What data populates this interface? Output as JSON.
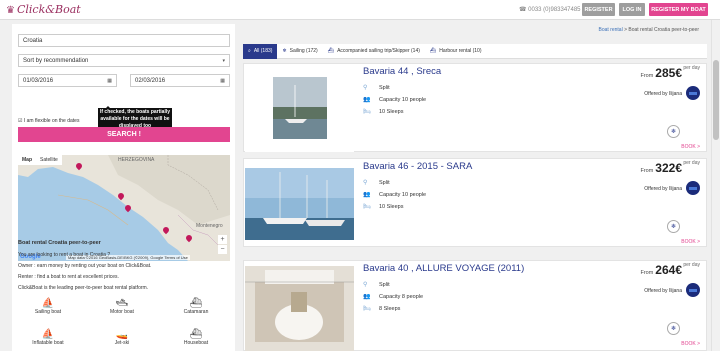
{
  "header": {
    "logo": "Click&Boat",
    "phone": "0033 (0)983347485",
    "register": "REGISTER",
    "login": "LOG IN",
    "register_boat": "REGISTER MY BOAT"
  },
  "search": {
    "destination": "Croatia",
    "sort": "Sort by recommendation",
    "date_from": "01/03/2016",
    "date_to": "02/03/2016",
    "flexible": "I am flexible on the dates",
    "tooltip": "If checked, the boats partially available for the dates will be displayed too",
    "button": "SEARCH !"
  },
  "map": {
    "map_tab": "Map",
    "satellite_tab": "Satellite",
    "labels": [
      "HERZEGOVINA",
      "Montenegro"
    ],
    "footer": "Map data ©2016 GeoBasis-DE/BKG (©2009), Google  Terms of Use",
    "google": "Google"
  },
  "info": {
    "title": "Boat rental Croatia peer-to-peer",
    "lines": [
      "You are looking to rent a boat in Croatia ?",
      "Owner : earn money by renting out your boat on Click&Boat.",
      "Renter : find a boat to rent at excellent prices.",
      "Click&Boat is the leading peer-to-peer boat rental platform."
    ]
  },
  "boat_types": [
    "Sailing boat",
    "Motor boat",
    "Catamaran",
    "Inflatable boat",
    "Jet-ski",
    "Houseboat"
  ],
  "breadcrumb": {
    "link": "Boat rental",
    "current": "Boat rental Croatia peer-to-peer"
  },
  "tabs": [
    {
      "label": "All (183)",
      "icon": "search-icon"
    },
    {
      "label": "Sailing (172)",
      "icon": "sailing-icon"
    },
    {
      "label": "Accompanied sailing trip/Skipper (14)",
      "icon": "skipper-icon"
    },
    {
      "label": "Harbour rental (10)",
      "icon": "harbour-icon"
    }
  ],
  "listings": [
    {
      "title": "Bavaria 44 , Sreca",
      "from": "From",
      "price": "285€",
      "per": "per day",
      "location": "Split",
      "capacity": "Capacity 10 people",
      "sleeps": "10 Sleeps",
      "offered": "Offered by Ilijana",
      "book": "BOOK >"
    },
    {
      "title": "Bavaria 46 - 2015 - SARA",
      "from": "From",
      "price": "322€",
      "per": "per day",
      "location": "Split",
      "capacity": "Capacity 10 people",
      "sleeps": "10 Sleeps",
      "offered": "Offered by Ilijana",
      "book": "BOOK >"
    },
    {
      "title": "Bavaria 40 , ALLURE VOYAGE (2011)",
      "from": "From",
      "price": "264€",
      "per": "per day",
      "location": "Split",
      "capacity": "Capacity 8 people",
      "sleeps": "8 Sleeps",
      "offered": "Offered by Ilijana",
      "book": "BOOK >"
    }
  ],
  "colors": {
    "brand": "#e24590",
    "primary": "#2a3a8c"
  }
}
